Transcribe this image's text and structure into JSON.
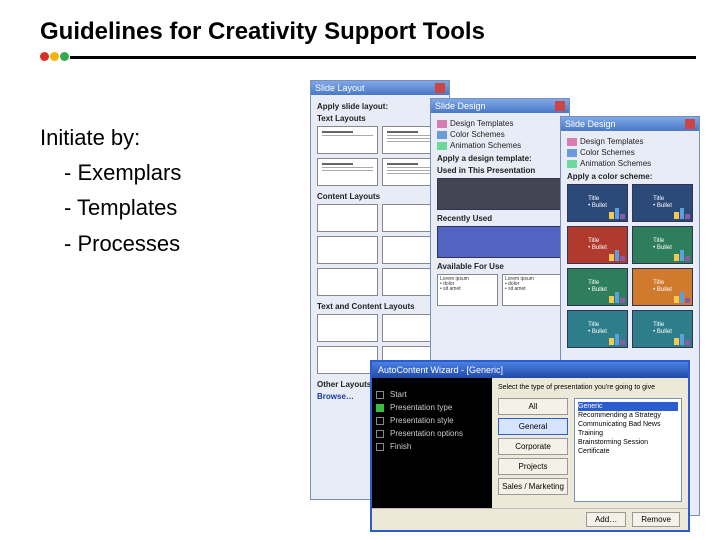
{
  "title": "Guidelines for Creativity Support Tools",
  "text": {
    "lead": "Initiate by:",
    "items": [
      "- Exemplars",
      "- Templates",
      "- Processes"
    ]
  },
  "layoutPane": {
    "title": "Slide Layout",
    "apply": "Apply slide layout:",
    "sections": {
      "text": "Text Layouts",
      "content": "Content Layouts",
      "textContent": "Text and Content Layouts",
      "other": "Other Layouts"
    },
    "browse": "Browse…"
  },
  "design1": {
    "title": "Slide Design",
    "options": [
      "Design Templates",
      "Color Schemes",
      "Animation Schemes"
    ],
    "apply": "Apply a design template:",
    "sections": {
      "used": "Used in This Presentation",
      "recent": "Recently Used",
      "avail": "Available For Use"
    }
  },
  "design2": {
    "title": "Slide Design",
    "options": [
      "Design Templates",
      "Color Schemes",
      "Animation Schemes"
    ],
    "apply": "Apply a color scheme:",
    "thumbText": {
      "title": "Title",
      "bullet": "• Bullet"
    }
  },
  "wizard": {
    "title": "AutoContent Wizard - [Generic]",
    "steps": [
      "Start",
      "Presentation type",
      "Presentation style",
      "Presentation options",
      "Finish"
    ],
    "prompt": "Select the type of presentation you're going to give",
    "cats": [
      "All",
      "General",
      "Corporate",
      "Projects",
      "Sales / Marketing"
    ],
    "list": [
      "Generic",
      "Recommending a Strategy",
      "Communicating Bad News",
      "Training",
      "Brainstorming Session",
      "Certificate"
    ],
    "footer": {
      "add": "Add…",
      "remove": "Remove"
    }
  }
}
